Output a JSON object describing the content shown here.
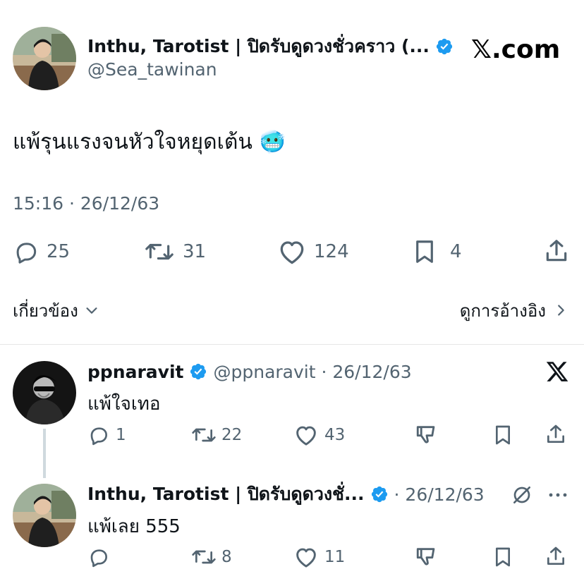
{
  "main_tweet": {
    "author_name": "Inthu, Tarotist | ปิดรับดูดวงชั่วคราว (...",
    "handle": "@Sea_tawinan",
    "site_logo": "𝕏.com",
    "text": "แพ้รุนแรงจนหัวใจหยุดเต้น",
    "emoji": "🥶",
    "timestamp": "15:16 · 26/12/63",
    "replies": "25",
    "reposts": "31",
    "likes": "124",
    "bookmarks": "4",
    "related_label": "เกี่ยวข้อง",
    "quotes_label": "ดูการอ้างอิง"
  },
  "reply_1": {
    "author_name": "ppnaravit",
    "handle_time": "@ppnaravit · 26/12/63",
    "text": "แพ้ใจเทอ",
    "replies": "1",
    "reposts": "22",
    "likes": "43"
  },
  "reply_2": {
    "author_name": "Inthu, Tarotist | ปิดรับดูดวงชั่...",
    "time": "· 26/12/63",
    "text": "แพ้เลย 555",
    "reposts": "8",
    "likes": "11"
  },
  "icons": {
    "verified": "verified-badge-icon",
    "reply": "reply-icon",
    "repost": "repost-icon",
    "like": "heart-icon",
    "bookmark": "bookmark-icon",
    "share": "share-icon",
    "downvote": "downvote-icon",
    "x_logo": "x-logo-icon",
    "grok": "grok-icon",
    "more": "more-icon"
  },
  "colors": {
    "text": "#0f1419",
    "secondary": "#536471",
    "verified": "#1d9bf0",
    "divider": "#e6e6e6"
  }
}
